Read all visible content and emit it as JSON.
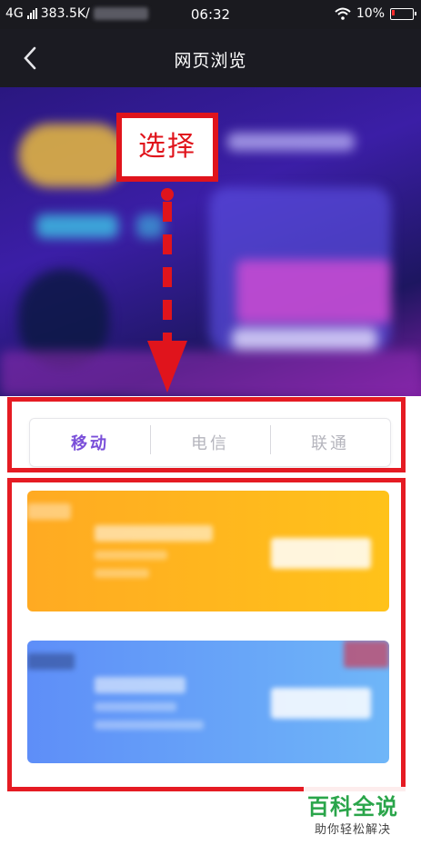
{
  "status_bar": {
    "network": "4G",
    "speed": "383.5K/",
    "time": "06:32",
    "battery": "10%"
  },
  "nav": {
    "title": "网页浏览",
    "back_icon": "chevron-left-icon"
  },
  "annotation": {
    "label": "选择",
    "color": "#e0141c"
  },
  "tabs": {
    "items": [
      {
        "label": "移动",
        "active": true
      },
      {
        "label": "电信",
        "active": false
      },
      {
        "label": "联通",
        "active": false
      }
    ],
    "active_color": "#7a4fd9"
  },
  "cards": [
    {
      "color": "#ffb21f"
    },
    {
      "color": "#6aa0f8"
    }
  ],
  "watermark": {
    "main": "百科全说",
    "sub": "助你轻松解决"
  }
}
